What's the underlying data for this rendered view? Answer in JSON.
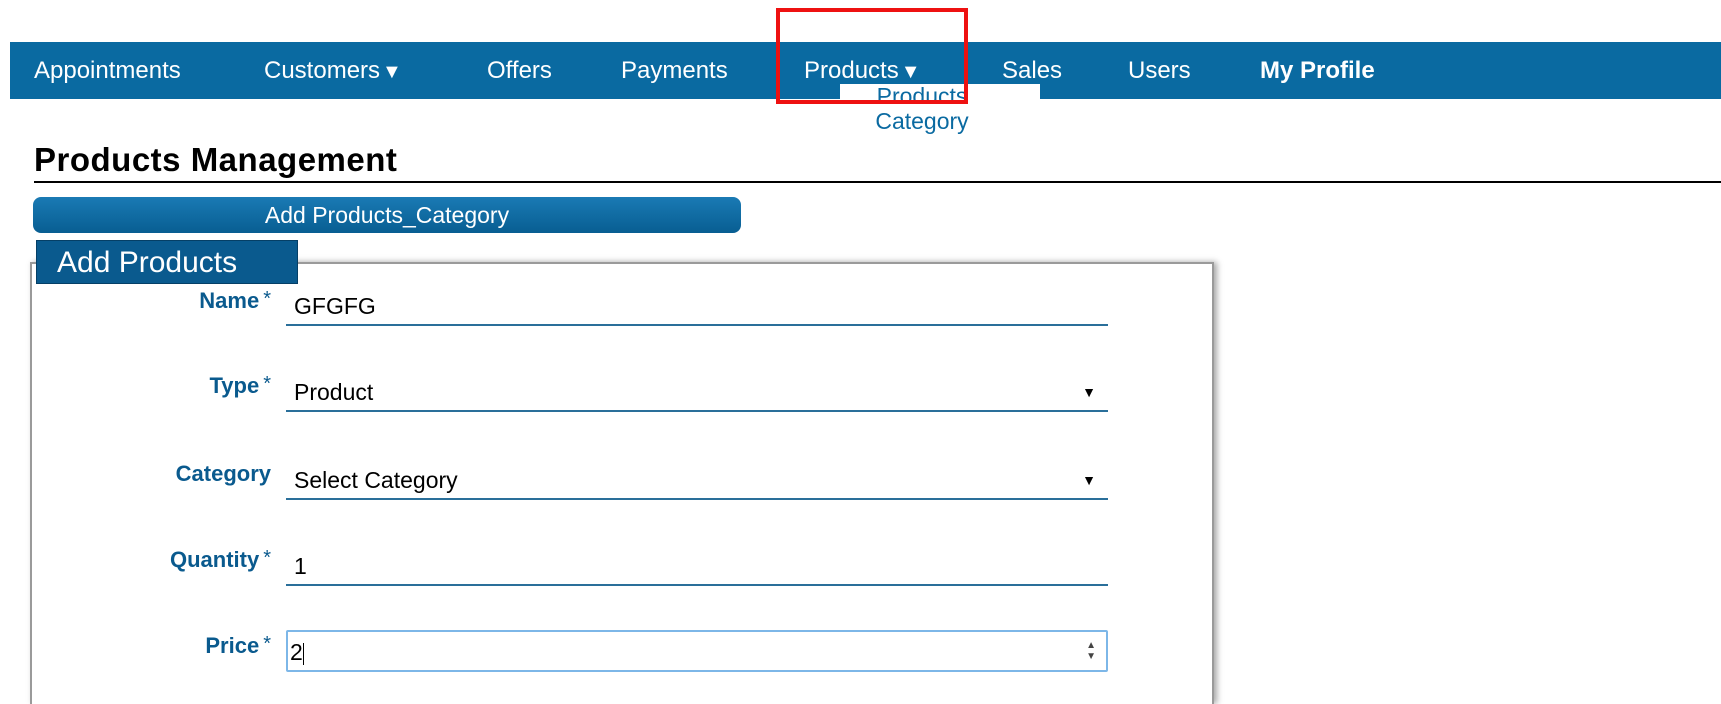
{
  "nav": {
    "items": [
      {
        "label": "Appointments"
      },
      {
        "label": "Customers",
        "arrow": "▼"
      },
      {
        "label": "Offers"
      },
      {
        "label": "Payments"
      },
      {
        "label": "Products",
        "arrow": "▼"
      },
      {
        "label": "Sales"
      },
      {
        "label": "Users"
      },
      {
        "label": "My Profile"
      }
    ],
    "products_dropdown": {
      "item": "Products Category"
    }
  },
  "page": {
    "title": "Products Management",
    "add_category_button": "Add Products_Category"
  },
  "form": {
    "panel_title": "Add Products",
    "required_mark": "*",
    "name": {
      "label": "Name",
      "value": "GFGFG"
    },
    "type": {
      "label": "Type",
      "value": "Product"
    },
    "category": {
      "label": "Category",
      "value": "Select Category"
    },
    "quantity": {
      "label": "Quantity",
      "value": "1"
    },
    "price": {
      "label": "Price",
      "value": "2"
    }
  },
  "colors": {
    "nav_bg": "#0a6aa1",
    "highlight": "#ee1111",
    "label": "#0a5a8e"
  },
  "icons": {
    "dropdown_arrow": "caret-down-icon",
    "select_arrow": "select-caret-icon",
    "number_spinner": "spinner-icon"
  }
}
